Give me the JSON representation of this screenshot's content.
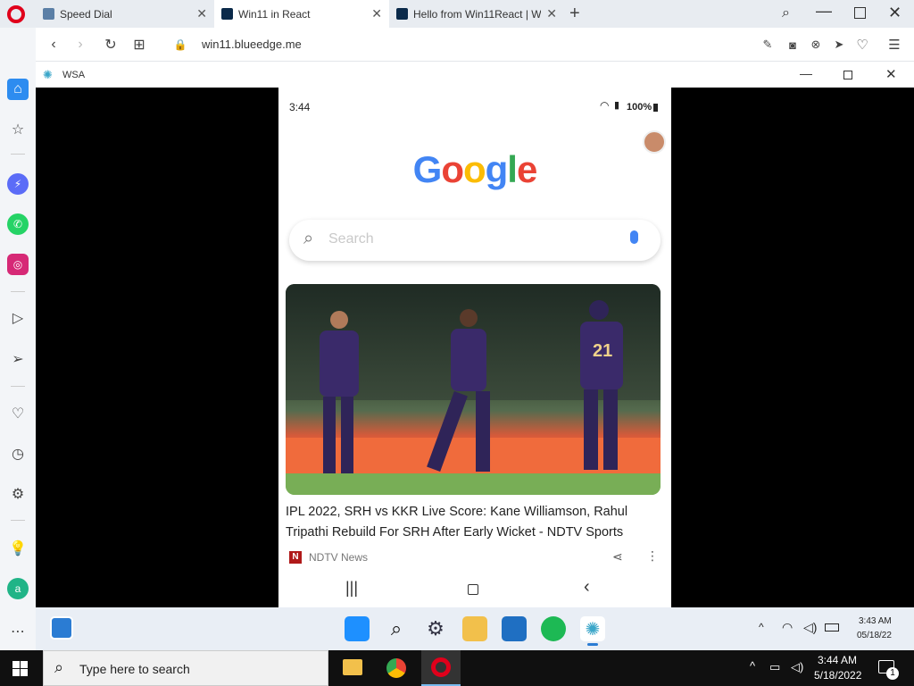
{
  "browser": {
    "tabs": [
      {
        "title": "Speed Dial",
        "active": false
      },
      {
        "title": "Win11 in React",
        "active": true
      },
      {
        "title": "Hello from Win11React | W",
        "active": false
      }
    ],
    "new_tab_label": "+",
    "url": "win11.blueedge.me"
  },
  "wsa": {
    "title": "WSA"
  },
  "phone": {
    "status_time": "3:44",
    "battery": "100%",
    "logo": "Google",
    "search_placeholder": "Search",
    "news": {
      "headline": "IPL 2022, SRH vs KKR Live Score: Kane Williamson, Rahul Tripathi Rebuild For SRH After Early Wicket - NDTV Sports",
      "source": "NDTV News",
      "source_badge": "N",
      "jersey_number": "21"
    }
  },
  "win11_taskbar": {
    "time": "3:43 AM",
    "date": "05/18/22"
  },
  "win10_taskbar": {
    "search_placeholder": "Type here to search",
    "time": "3:44 AM",
    "date": "5/18/2022",
    "notification_count": "1"
  },
  "colors": {
    "opera_red": "#e0001b",
    "google_blue": "#4285f4",
    "google_red": "#ea4335",
    "google_yellow": "#fbbc05",
    "google_green": "#34a853",
    "taskbar_dark": "#101010"
  }
}
